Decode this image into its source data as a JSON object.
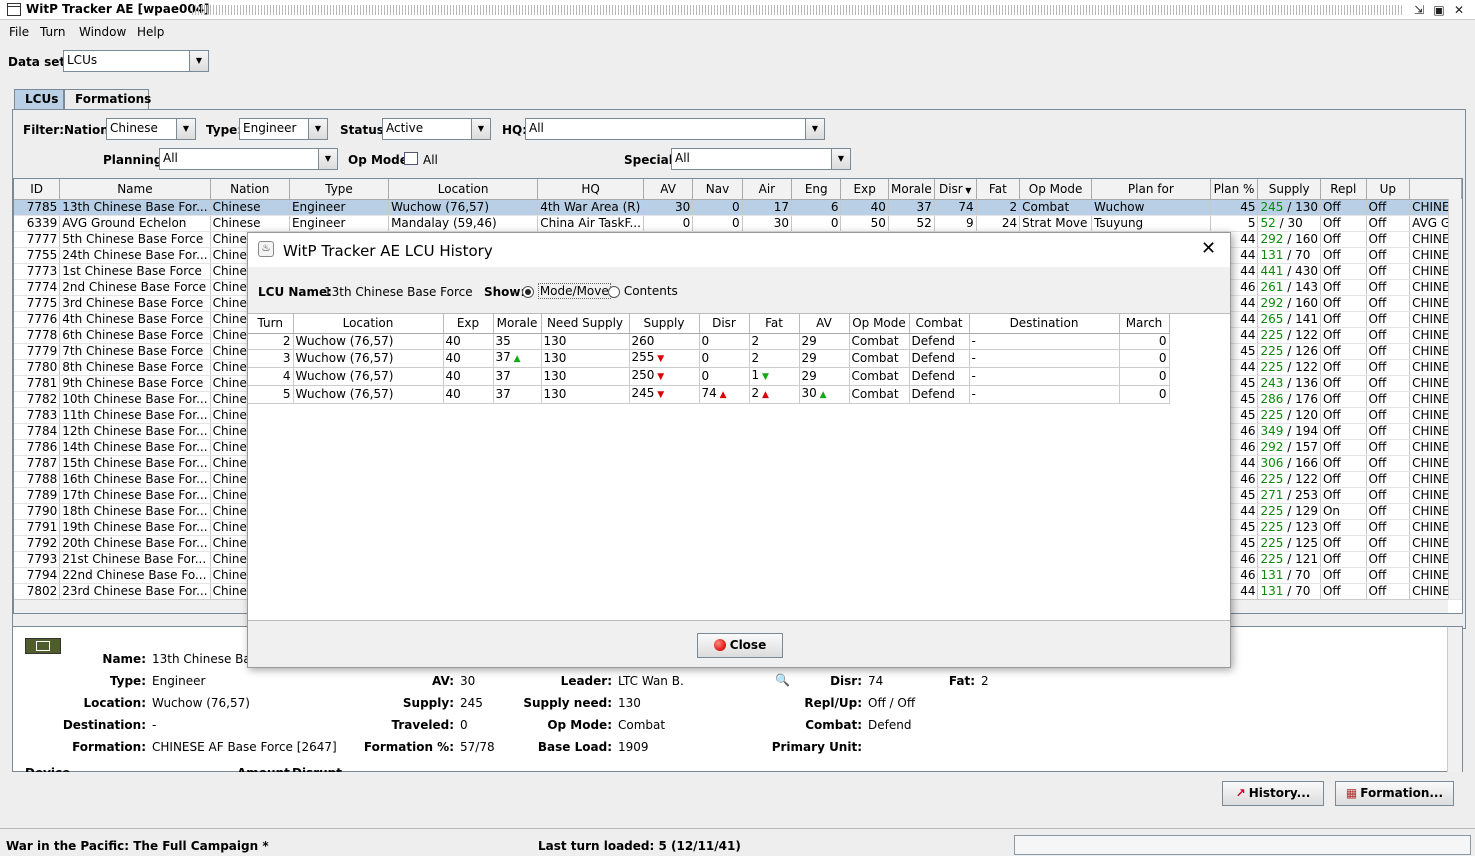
{
  "window": {
    "title": "WitP Tracker AE [wpae004]"
  },
  "menu": [
    "File",
    "Turn",
    "Window",
    "Help"
  ],
  "dataset": {
    "label": "Data set:",
    "value": "LCUs"
  },
  "tabs": [
    "LCUs",
    "Formations"
  ],
  "filter": {
    "label": "Filter:",
    "nation_label": "Nation:",
    "nation": "Chinese",
    "type_label": "Type:",
    "type": "Engineer",
    "status_label": "Status:",
    "status": "Active",
    "hq_label": "HQ:",
    "hq": "All",
    "planning_label": "Planning:",
    "planning": "All",
    "opmode_label": "Op Mode:",
    "opmode": "All",
    "special_label": "Special:",
    "special": "All"
  },
  "table": {
    "columns": [
      "ID",
      "Name",
      "Nation",
      "Type",
      "Location",
      "HQ",
      "AV",
      "Nav",
      "Air",
      "Eng",
      "Exp",
      "Morale",
      "Disr",
      "Fat",
      "Op Mode",
      "Plan for",
      "Plan %",
      "Supply",
      "Repl",
      "Up",
      ""
    ],
    "rows": [
      [
        "7785",
        "13th Chinese Base For...",
        "Chinese",
        "Engineer",
        "Wuchow (76,57)",
        "4th War Area (R)",
        "30",
        "0",
        "17",
        "6",
        "40",
        "37",
        "74",
        "2",
        "Combat",
        "Wuchow",
        "45",
        "245",
        "130",
        "Off",
        "Off",
        "CHINE"
      ],
      [
        "6339",
        "AVG Ground Echelon",
        "Chinese",
        "Engineer",
        "Mandalay (59,46)",
        "China Air TaskF...",
        "0",
        "0",
        "30",
        "0",
        "50",
        "52",
        "9",
        "24",
        "Strat Move",
        "Tsuyung",
        "5",
        "52",
        "30",
        "Off",
        "Off",
        "AVG G"
      ],
      [
        "7777",
        "5th Chinese Base Force",
        "Chinese",
        "",
        "",
        "",
        "",
        "",
        "",
        "",
        "",
        "",
        "",
        "",
        "",
        "",
        "44",
        "292",
        "160",
        "Off",
        "Off",
        "CHINE"
      ],
      [
        "7755",
        "24th Chinese Base For...",
        "Chinese",
        "",
        "",
        "",
        "",
        "",
        "",
        "",
        "",
        "",
        "",
        "",
        "",
        "",
        "44",
        "131",
        "70",
        "Off",
        "Off",
        "CHINE"
      ],
      [
        "7773",
        "1st Chinese Base Force",
        "Chinese",
        "",
        "",
        "",
        "",
        "",
        "",
        "",
        "",
        "",
        "",
        "",
        "",
        "",
        "44",
        "441",
        "430",
        "Off",
        "Off",
        "CHINE"
      ],
      [
        "7774",
        "2nd Chinese Base Force",
        "Chinese",
        "",
        "",
        "",
        "",
        "",
        "",
        "",
        "",
        "",
        "",
        "",
        "",
        "",
        "46",
        "261",
        "143",
        "Off",
        "Off",
        "CHINE"
      ],
      [
        "7775",
        "3rd Chinese Base Force",
        "Chinese",
        "",
        "",
        "",
        "",
        "",
        "",
        "",
        "",
        "",
        "",
        "",
        "",
        "",
        "44",
        "292",
        "160",
        "Off",
        "Off",
        "CHINE"
      ],
      [
        "7776",
        "4th Chinese Base Force",
        "Chinese",
        "",
        "",
        "",
        "",
        "",
        "",
        "",
        "",
        "",
        "",
        "",
        "",
        "",
        "44",
        "265",
        "141",
        "Off",
        "Off",
        "CHINE"
      ],
      [
        "7778",
        "6th Chinese Base Force",
        "Chinese",
        "",
        "",
        "",
        "",
        "",
        "",
        "",
        "",
        "",
        "",
        "",
        "",
        "",
        "44",
        "225",
        "122",
        "Off",
        "Off",
        "CHINE"
      ],
      [
        "7779",
        "7th Chinese Base Force",
        "Chinese",
        "",
        "",
        "",
        "",
        "",
        "",
        "",
        "",
        "",
        "",
        "",
        "",
        "",
        "45",
        "225",
        "126",
        "Off",
        "Off",
        "CHINE"
      ],
      [
        "7780",
        "8th Chinese Base Force",
        "Chinese",
        "",
        "",
        "",
        "",
        "",
        "",
        "",
        "",
        "",
        "",
        "",
        "",
        "",
        "44",
        "225",
        "122",
        "Off",
        "Off",
        "CHINE"
      ],
      [
        "7781",
        "9th Chinese Base Force",
        "Chinese",
        "",
        "",
        "",
        "",
        "",
        "",
        "",
        "",
        "",
        "",
        "",
        "",
        "",
        "45",
        "243",
        "136",
        "Off",
        "Off",
        "CHINE"
      ],
      [
        "7782",
        "10th Chinese Base For...",
        "Chinese",
        "",
        "",
        "",
        "",
        "",
        "",
        "",
        "",
        "",
        "",
        "",
        "",
        "",
        "45",
        "286",
        "176",
        "Off",
        "Off",
        "CHINE"
      ],
      [
        "7783",
        "11th Chinese Base For...",
        "Chinese",
        "",
        "",
        "",
        "",
        "",
        "",
        "",
        "",
        "",
        "",
        "",
        "",
        "",
        "45",
        "225",
        "120",
        "Off",
        "Off",
        "CHINE"
      ],
      [
        "7784",
        "12th Chinese Base For...",
        "Chinese",
        "",
        "",
        "",
        "",
        "",
        "",
        "",
        "",
        "",
        "",
        "",
        "",
        "",
        "46",
        "349",
        "194",
        "Off",
        "Off",
        "CHINE"
      ],
      [
        "7786",
        "14th Chinese Base For...",
        "Chinese",
        "",
        "",
        "",
        "",
        "",
        "",
        "",
        "",
        "",
        "",
        "",
        "",
        "",
        "46",
        "292",
        "157",
        "Off",
        "Off",
        "CHINE"
      ],
      [
        "7787",
        "15th Chinese Base For...",
        "Chinese",
        "",
        "",
        "",
        "",
        "",
        "",
        "",
        "",
        "",
        "",
        "",
        "",
        "",
        "44",
        "306",
        "166",
        "Off",
        "Off",
        "CHINE"
      ],
      [
        "7788",
        "16th Chinese Base For...",
        "Chinese",
        "",
        "",
        "",
        "",
        "",
        "",
        "",
        "",
        "",
        "",
        "",
        "",
        "",
        "46",
        "225",
        "122",
        "Off",
        "Off",
        "CHINE"
      ],
      [
        "7789",
        "17th Chinese Base For...",
        "Chinese",
        "",
        "",
        "",
        "",
        "",
        "",
        "",
        "",
        "",
        "",
        "",
        "",
        "",
        "45",
        "271",
        "253",
        "Off",
        "Off",
        "CHINE"
      ],
      [
        "7790",
        "18th Chinese Base For...",
        "Chinese",
        "",
        "",
        "",
        "",
        "",
        "",
        "",
        "",
        "",
        "",
        "",
        "",
        "",
        "44",
        "225",
        "129",
        "On",
        "Off",
        "CHINE"
      ],
      [
        "7791",
        "19th Chinese Base For...",
        "Chinese",
        "",
        "",
        "",
        "",
        "",
        "",
        "",
        "",
        "",
        "",
        "",
        "",
        "",
        "45",
        "225",
        "123",
        "Off",
        "Off",
        "CHINE"
      ],
      [
        "7792",
        "20th Chinese Base For...",
        "Chinese",
        "",
        "",
        "",
        "",
        "",
        "",
        "",
        "",
        "",
        "",
        "",
        "",
        "",
        "45",
        "225",
        "125",
        "Off",
        "Off",
        "CHINE"
      ],
      [
        "7793",
        "21st Chinese Base For...",
        "Chinese",
        "",
        "",
        "",
        "",
        "",
        "",
        "",
        "",
        "",
        "",
        "",
        "",
        "",
        "46",
        "225",
        "121",
        "Off",
        "Off",
        "CHINE"
      ],
      [
        "7794",
        "22nd Chinese Base Fo...",
        "Chinese",
        "",
        "",
        "",
        "",
        "",
        "",
        "",
        "",
        "",
        "",
        "",
        "",
        "",
        "46",
        "131",
        "70",
        "Off",
        "Off",
        "CHINE"
      ],
      [
        "7802",
        "23rd Chinese Base For...",
        "Chinese",
        "",
        "",
        "",
        "",
        "",
        "",
        "",
        "",
        "",
        "",
        "",
        "",
        "",
        "44",
        "131",
        "70",
        "Off",
        "Off",
        "CHINE"
      ]
    ]
  },
  "detail": {
    "name_label": "Name:",
    "name": "13th Chinese Base Force",
    "type_label": "Type:",
    "type": "Engineer",
    "location_label": "Location:",
    "location": "Wuchow (76,57)",
    "destination_label": "Destination:",
    "destination": "-",
    "formation_label": "Formation:",
    "formation": "CHINESE AF Base Force [2647]",
    "av_label": "AV:",
    "av": "30",
    "supply_label": "Supply:",
    "supply": "245",
    "traveled_label": "Traveled:",
    "traveled": "0",
    "formation_pct_label": "Formation %:",
    "formation_pct": "57/78",
    "leader_label": "Leader:",
    "leader": "LTC Wan B.",
    "supply_need_label": "Supply need:",
    "supply_need": "130",
    "opmode_label": "Op Mode:",
    "opmode": "Combat",
    "baseload_label": "Base Load:",
    "baseload": "1909",
    "disr_label": "Disr:",
    "disr": "74",
    "fat_label": "Fat:",
    "fat": "2",
    "replup_label": "Repl/Up:",
    "replup": "Off / Off",
    "combat_label": "Combat:",
    "combat": "Defend",
    "primary_label": "Primary Unit:",
    "primary": "",
    "device_label": "Device",
    "amount_label": "Amount",
    "disrupt_label": "Disrupt"
  },
  "buttons": {
    "history": "History...",
    "formation": "Formation..."
  },
  "status": {
    "left": "War in the Pacific: The Full Campaign  *",
    "turn": "Last turn loaded: 5 (12/11/41)"
  },
  "dialog": {
    "title": "WitP Tracker AE LCU History",
    "lcu_label": "LCU Name:",
    "lcu_name": "13th Chinese Base Force",
    "show_label": "Show:",
    "opt1": "Mode/Move",
    "opt2": "Contents",
    "columns": [
      "Turn",
      "Location",
      "Exp",
      "Morale",
      "Need Supply",
      "Supply",
      "Disr",
      "Fat",
      "AV",
      "Op Mode",
      "Combat",
      "Destination",
      "March"
    ],
    "rows": [
      {
        "turn": "2",
        "location": "Wuchow (76,57)",
        "exp": "40",
        "morale": "35",
        "morale_t": "",
        "need": "130",
        "supply": "260",
        "supply_t": "",
        "disr": "0",
        "disr_t": "",
        "fat": "2",
        "fat_t": "",
        "av": "29",
        "av_t": "",
        "opmode": "Combat",
        "combat": "Defend",
        "dest": "-",
        "march": "0"
      },
      {
        "turn": "3",
        "location": "Wuchow (76,57)",
        "exp": "40",
        "morale": "37",
        "morale_t": "upg",
        "need": "130",
        "supply": "255",
        "supply_t": "dn",
        "disr": "0",
        "disr_t": "",
        "fat": "2",
        "fat_t": "",
        "av": "29",
        "av_t": "",
        "opmode": "Combat",
        "combat": "Defend",
        "dest": "-",
        "march": "0"
      },
      {
        "turn": "4",
        "location": "Wuchow (76,57)",
        "exp": "40",
        "morale": "37",
        "morale_t": "",
        "need": "130",
        "supply": "250",
        "supply_t": "dn",
        "disr": "0",
        "disr_t": "",
        "fat": "1",
        "fat_t": "dng",
        "av": "29",
        "av_t": "",
        "opmode": "Combat",
        "combat": "Defend",
        "dest": "-",
        "march": "0"
      },
      {
        "turn": "5",
        "location": "Wuchow (76,57)",
        "exp": "40",
        "morale": "37",
        "morale_t": "",
        "need": "130",
        "supply": "245",
        "supply_t": "dn",
        "disr": "74",
        "disr_t": "up",
        "fat": "2",
        "fat_t": "up",
        "av": "30",
        "av_t": "upg",
        "opmode": "Combat",
        "combat": "Defend",
        "dest": "-",
        "march": "0"
      }
    ],
    "close": "Close"
  },
  "colors": {
    "selection": "#b8cfe5",
    "supply_green": "#0a8a0a",
    "trend_red": "#d00000",
    "trend_green": "#11aa11"
  }
}
